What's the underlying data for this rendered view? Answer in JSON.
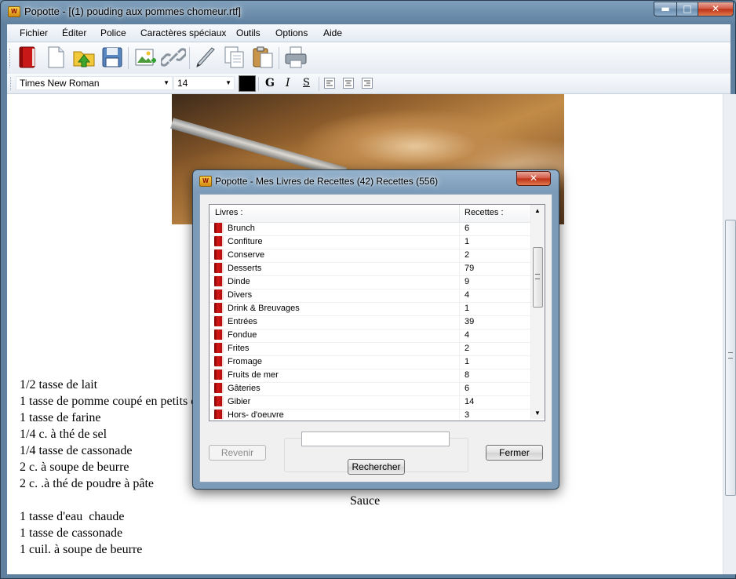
{
  "window": {
    "title": "Popotte - [(1) pouding aux pommes chomeur.rtf]",
    "minimize": "▬",
    "maximize": "□",
    "close": "✕"
  },
  "menu": [
    "Fichier",
    "Éditer",
    "Police",
    "Caractères spéciaux",
    "Outils",
    "Options",
    "Aide"
  ],
  "format_bar": {
    "font_name": "Times New Roman",
    "font_size": "14",
    "bold": "G",
    "italic": "I",
    "strike": "S"
  },
  "document": {
    "lines": [
      "1/2 tasse de lait",
      "1 tasse de pomme coupé en petits cubes",
      "1 tasse de farine",
      "1/4 c. à thé de sel",
      "1/4 tasse de cassonade",
      "2 c. à soupe de beurre",
      "2 c. .à thé de poudre à pâte"
    ],
    "sauce_heading": "Sauce",
    "sauce_lines": [
      "1 tasse d'eau  chaude",
      "1 tasse de cassonade",
      "1 cuil. à soupe de beurre"
    ]
  },
  "dialog": {
    "title": "Popotte - Mes Livres de Recettes (42) Recettes (556)",
    "close": "✕",
    "col_books": "Livres :",
    "col_recipes": "Recettes :",
    "rows": [
      {
        "name": "Brunch",
        "count": "6"
      },
      {
        "name": "Confiture",
        "count": "1"
      },
      {
        "name": "Conserve",
        "count": "2"
      },
      {
        "name": "Desserts",
        "count": "79"
      },
      {
        "name": "Dinde",
        "count": "9"
      },
      {
        "name": "Divers",
        "count": "4"
      },
      {
        "name": "Drink & Breuvages",
        "count": "1"
      },
      {
        "name": "Entrées",
        "count": "39"
      },
      {
        "name": "Fondue",
        "count": "4"
      },
      {
        "name": "Frites",
        "count": "2"
      },
      {
        "name": "Fromage",
        "count": "1"
      },
      {
        "name": "Fruits de mer",
        "count": "8"
      },
      {
        "name": "Gâteries",
        "count": "6"
      },
      {
        "name": "Gibier",
        "count": "14"
      },
      {
        "name": "Hors- d'oeuvre",
        "count": "3"
      }
    ],
    "search_value": "",
    "btn_back": "Revenir",
    "btn_search": "Rechercher",
    "btn_close": "Fermer"
  }
}
